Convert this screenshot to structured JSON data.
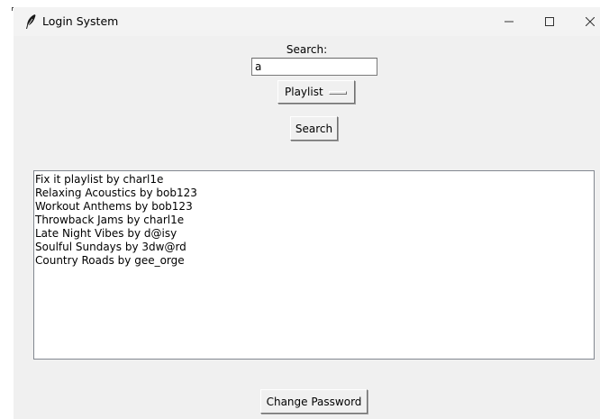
{
  "window": {
    "title": "Login System",
    "icons": {
      "app": "feather-icon",
      "minimize": "minimize-icon",
      "maximize": "maximize-icon",
      "close": "close-icon"
    }
  },
  "search": {
    "label": "Search:",
    "value": "a",
    "type_selected": "Playlist",
    "button_label": "Search"
  },
  "results": [
    "Fix it playlist by charl1e",
    "Relaxing Acoustics by bob123",
    "Workout Anthems by bob123",
    "Throwback Jams by charl1e",
    "Late Night Vibes by d@isy",
    "Soulful Sundays by 3dw@rd",
    "Country Roads by gee_orge"
  ],
  "footer": {
    "change_password_label": "Change Password"
  },
  "colors": {
    "window_bg": "#f0f0f0",
    "titlebar_bg": "#f3f3f3",
    "list_bg": "#ffffff",
    "border": "#828790"
  }
}
